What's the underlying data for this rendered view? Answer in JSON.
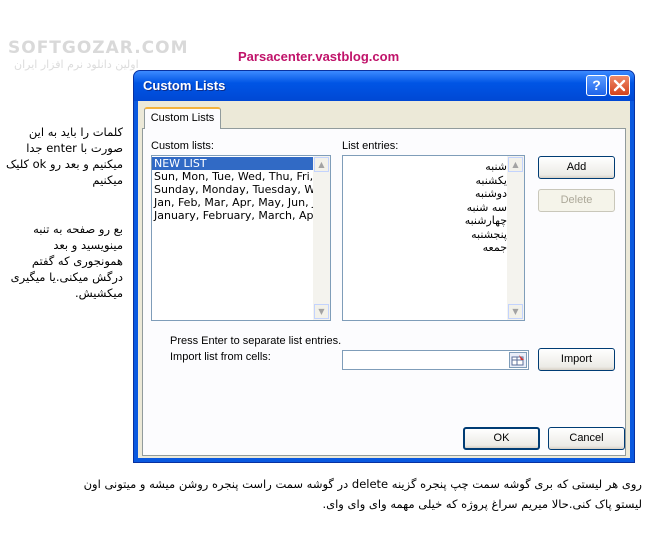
{
  "watermark": {
    "brand": "SOFTGOZAR.COM",
    "tagline": "اولین دانلود نرم افزار ایران"
  },
  "site": "Parsacenter.vastblog.com",
  "notes": [
    "کلمات را باید به این صورت با enter جدا میکنیم و بعد رو ok کلیک میکنیم",
    "بع رو صفحه به تنبه مینویسید و بعد همونجوری که گفتم درگش میکنی.یا میگیری میکشیش."
  ],
  "bottom_text": "روی هر لیستی که بری گوشه سمت چپ پنجره گزینه delete در گوشه سمت راست پنجره روشن میشه و میتونی اون لیستو پاک کنی.حالا میریم سراغ پروژه که خیلی مهمه وای وای وای.",
  "dialog": {
    "title": "Custom Lists",
    "help": "?",
    "tab": "Custom Lists",
    "custom_lists_label": "Custom lists:",
    "custom_lists": [
      "NEW LIST",
      "Sun, Mon, Tue, Wed, Thu, Fri, S",
      "Sunday, Monday, Tuesday, Wed",
      "Jan, Feb, Mar, Apr, May, Jun, J",
      "January, February, March, April"
    ],
    "list_entries_label": "List entries:",
    "list_entries": [
      "شنبه",
      "یکشنبه",
      "دوشنبه",
      "سه شنبه",
      "چهارشنبه",
      "پنجشنبه",
      "جمعه"
    ],
    "add": "Add",
    "delete": "Delete",
    "hint": "Press Enter to separate list entries.",
    "import_label": "Import list from cells:",
    "import_value": "",
    "import": "Import",
    "ok": "OK",
    "cancel": "Cancel"
  }
}
